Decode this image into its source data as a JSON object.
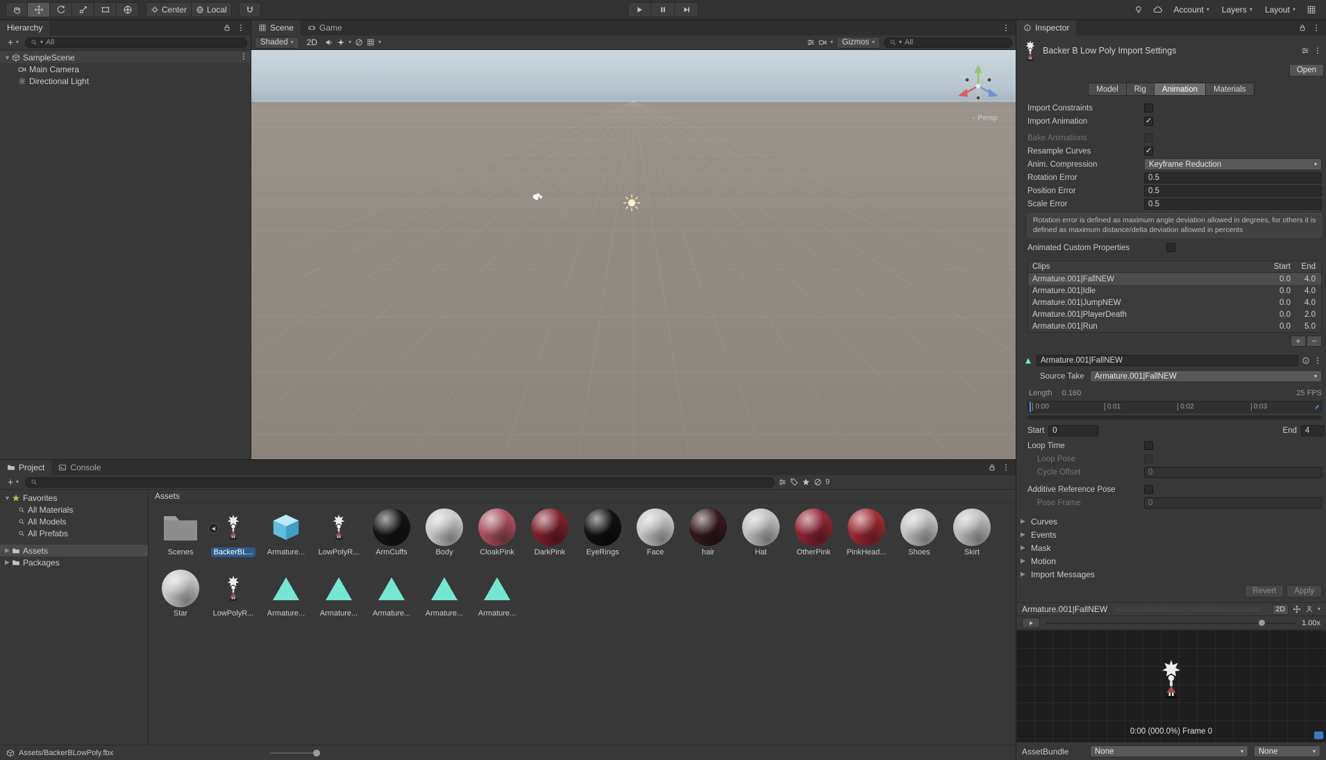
{
  "colors": {
    "selection": "#2d5c8a",
    "anim_clip_teal": "#74e6d2",
    "model_icon_blue": "#7fd0ee",
    "favorites_star": "#c9b35a",
    "playhead_blue": "#4a90d9"
  },
  "icons": {
    "search": "magnifier",
    "lock": "padlock",
    "menu": "⋮",
    "dropdown_caret": "▾",
    "foldout_collapsed": "▶",
    "foldout_expanded": "▼",
    "play": "▶",
    "pause": "❚❚",
    "step": "▶❚",
    "star": "★",
    "hidden": "∅",
    "subasset_expand": "◀"
  },
  "toolbar": {
    "pivot_mode": "Center",
    "orientation_mode": "Local",
    "account": "Account",
    "layers": "Layers",
    "layout": "Layout"
  },
  "hierarchy": {
    "tab": "Hierarchy",
    "search_filter": "All",
    "scene_name": "SampleScene",
    "items": [
      {
        "label": "Main Camera"
      },
      {
        "label": "Directional Light"
      }
    ]
  },
  "scene_view": {
    "tab_scene": "Scene",
    "tab_game": "Game",
    "shading_mode": "Shaded",
    "toggle_2d": "2D",
    "gizmos": "Gizmos",
    "search_filter": "All",
    "projection": "Persp"
  },
  "project": {
    "tab_project": "Project",
    "tab_console": "Console",
    "favorites_label": "Favorites",
    "favorites": [
      {
        "label": "All Materials"
      },
      {
        "label": "All Models"
      },
      {
        "label": "All Prefabs"
      }
    ],
    "roots": [
      {
        "label": "Assets"
      },
      {
        "label": "Packages"
      }
    ],
    "breadcrumb": "Assets",
    "hidden_count": "9",
    "assets_row1": [
      {
        "label": "Scenes",
        "type": "folder"
      },
      {
        "label": "BackerBL...",
        "type": "model",
        "selected": true
      },
      {
        "label": "Armature...",
        "type": "model-cube"
      },
      {
        "label": "LowPolyR...",
        "type": "model"
      },
      {
        "label": "ArmCuffs",
        "type": "material",
        "color": "#141414"
      },
      {
        "label": "Body",
        "type": "material",
        "color": "#c9c9c9"
      },
      {
        "label": "CloakPink",
        "type": "material",
        "color": "#a8505f"
      },
      {
        "label": "DarkPink",
        "type": "material",
        "color": "#7e1f2d"
      },
      {
        "label": "EyeRings",
        "type": "material",
        "color": "#101010"
      },
      {
        "label": "Face",
        "type": "material",
        "color": "#c6c6c6"
      },
      {
        "label": "hair",
        "type": "material",
        "color": "#33181d"
      },
      {
        "label": "Hat",
        "type": "material",
        "color": "#bfbfbf"
      },
      {
        "label": "OtherPink",
        "type": "material",
        "color": "#8f2433"
      },
      {
        "label": "PinkHead...",
        "type": "material",
        "color": "#9c2a33"
      },
      {
        "label": "Shoes",
        "type": "material",
        "color": "#c2c2c2"
      },
      {
        "label": "Skirt",
        "type": "material",
        "color": "#bdbdbd"
      }
    ],
    "assets_row2": [
      {
        "label": "Star",
        "type": "material",
        "color": "#c8c8c8"
      },
      {
        "label": "LowPolyR...",
        "type": "model"
      },
      {
        "label": "Armature...",
        "type": "animation"
      },
      {
        "label": "Armature...",
        "type": "animation"
      },
      {
        "label": "Armature...",
        "type": "animation"
      },
      {
        "label": "Armature...",
        "type": "animation"
      },
      {
        "label": "Armature...",
        "type": "animation"
      }
    ],
    "selected_asset_path": "Assets/BackerBLowPoly.fbx"
  },
  "inspector": {
    "tab": "Inspector",
    "title": "Backer B Low Poly Import Settings",
    "open_button": "Open",
    "tabs": [
      {
        "label": "Model"
      },
      {
        "label": "Rig"
      },
      {
        "label": "Animation"
      },
      {
        "label": "Materials"
      }
    ],
    "import_constraints_label": "Import Constraints",
    "import_animation_label": "Import Animation",
    "bake_animations_label": "Bake Animations",
    "resample_curves_label": "Resample Curves",
    "anim_compression_label": "Anim. Compression",
    "anim_compression_value": "Keyframe Reduction",
    "rotation_error_label": "Rotation Error",
    "rotation_error_value": "0.5",
    "position_error_label": "Position Error",
    "position_error_value": "0.5",
    "scale_error_label": "Scale Error",
    "scale_error_value": "0.5",
    "error_help": "Rotation error is defined as maximum angle deviation allowed in degrees, for others it is defined as maximum distance/delta deviation allowed in percents",
    "animated_custom_label": "Animated Custom Properties",
    "clips": {
      "header_name": "Clips",
      "header_start": "Start",
      "header_end": "End",
      "rows": [
        {
          "name": "Armature.001|FallNEW",
          "start": "0.0",
          "end": "4.0"
        },
        {
          "name": "Armature.001|Idle",
          "start": "0.0",
          "end": "4.0"
        },
        {
          "name": "Armature.001|JumpNEW",
          "start": "0.0",
          "end": "4.0"
        },
        {
          "name": "Armature.001|PlayerDeath",
          "start": "0.0",
          "end": "2.0"
        },
        {
          "name": "Armature.001|Run",
          "start": "0.0",
          "end": "5.0"
        }
      ]
    },
    "clip_name": "Armature.001|FallNEW",
    "source_take_label": "Source Take",
    "source_take_value": "Armature.001|FallNEW",
    "length_label": "Length",
    "length_value": "0.160",
    "fps_label": "25 FPS",
    "ruler_ticks": [
      "0:00",
      "0:01",
      "0:02",
      "0:03"
    ],
    "start_label": "Start",
    "start_value": "0",
    "end_label": "End",
    "end_value": "4",
    "loop_time_label": "Loop Time",
    "loop_pose_label": "Loop Pose",
    "cycle_offset_label": "Cycle Offset",
    "cycle_offset_value": "0",
    "additive_label": "Additive Reference Pose",
    "pose_frame_label": "Pose Frame",
    "pose_frame_value": "0",
    "foldouts": [
      {
        "label": "Curves"
      },
      {
        "label": "Events"
      },
      {
        "label": "Mask"
      },
      {
        "label": "Motion"
      },
      {
        "label": "Import Messages"
      }
    ],
    "revert_button": "Revert",
    "apply_button": "Apply",
    "preview": {
      "title": "Armature.001|FallNEW",
      "toggle_2d": "2D",
      "speed": "1.00x",
      "frame_info": "0:00 (000.0%) Frame 0"
    },
    "assetbundle_label": "AssetBundle",
    "assetbundle_value": "None",
    "assetbundle_variant": "None"
  }
}
